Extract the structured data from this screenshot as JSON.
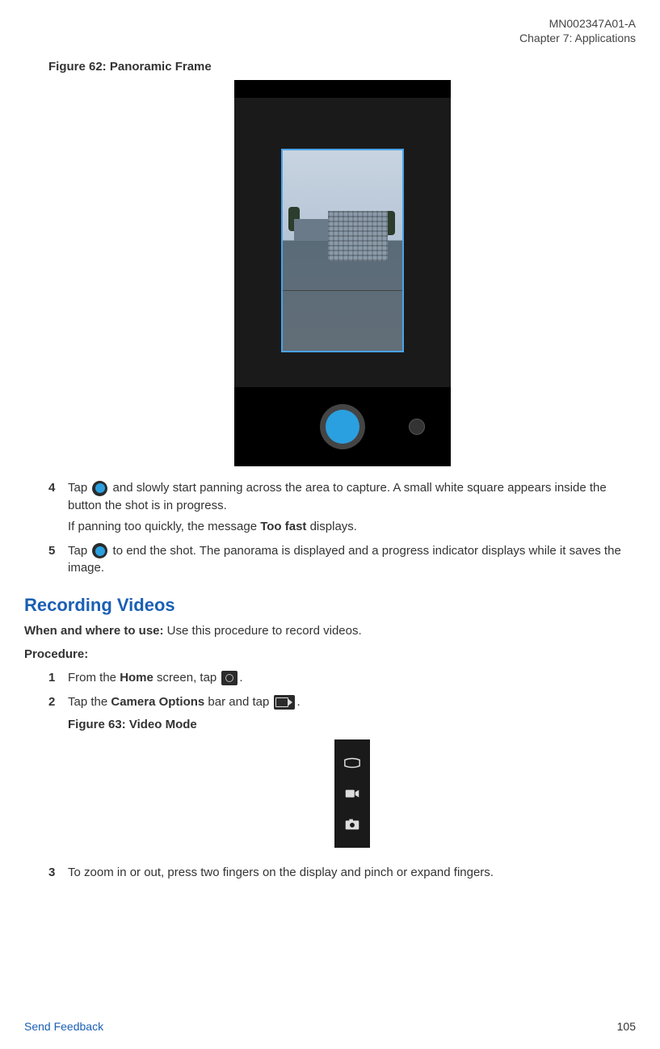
{
  "doc_id": "MN002347A01-A",
  "chapter_label": "Chapter 7:  Applications",
  "figure62_label": "Figure 62: Panoramic Frame",
  "steps_panorama": {
    "s4": {
      "num": "4",
      "part1": "Tap ",
      "part2": " and slowly start panning across the area to capture. A small white square appears inside the button the shot is in progress.",
      "line2a": "If panning too quickly, the message ",
      "line2_bold": "Too fast",
      "line2b": " displays."
    },
    "s5": {
      "num": "5",
      "part1": "Tap ",
      "part2": " to end the shot. The panorama is displayed and a progress indicator displays while it saves the image."
    }
  },
  "section_title": "Recording Videos",
  "when_label": "When and where to use:",
  "when_text": " Use this procedure to record videos.",
  "procedure_label": "Procedure:",
  "steps_video": {
    "s1": {
      "num": "1",
      "part1": "From the ",
      "bold1": "Home",
      "part2": " screen, tap ",
      "part3": "."
    },
    "s2": {
      "num": "2",
      "part1": "Tap the ",
      "bold1": "Camera Options",
      "part2": " bar and tap ",
      "part3": "."
    },
    "s3": {
      "num": "3",
      "text": "To zoom in or out, press two fingers on the display and pinch or expand fingers."
    }
  },
  "figure63_label": "Figure 63: Video Mode",
  "footer_send": "Send Feedback",
  "footer_page": "105"
}
